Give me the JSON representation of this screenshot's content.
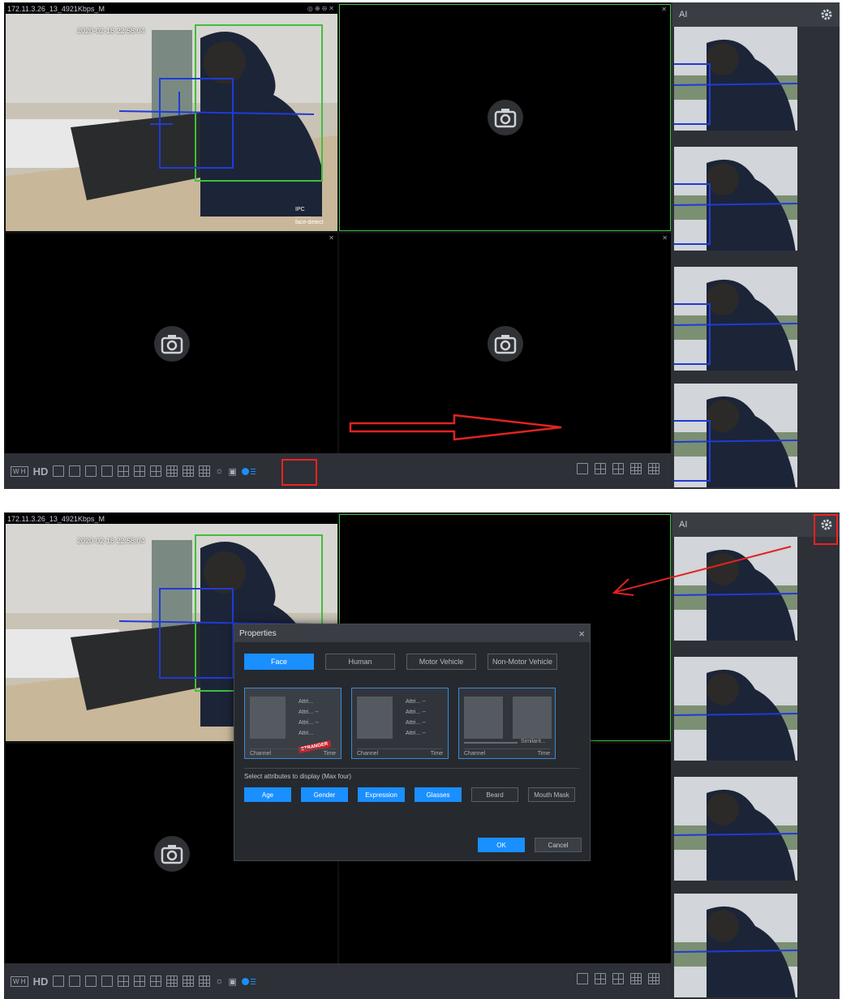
{
  "channel_title": "172.11.3.26_13_4921Kbps_M",
  "osd_timestamp": "2020-02-18 22:58:04",
  "osd_lines": [
    "IPC",
    "..........",
    "",
    "face-detect"
  ],
  "toolbar": {
    "wh_label": "W H",
    "hd_label": "HD"
  },
  "ai_panel": {
    "title": "AI"
  },
  "dialog": {
    "title": "Properties",
    "close": "×",
    "tabs": [
      "Face",
      "Human",
      "Motor Vehicle",
      "Non-Motor Vehicle"
    ],
    "previews": [
      {
        "attrs": [
          "Attri...",
          "Attri... --",
          "Attri... --",
          "Attri..."
        ],
        "channel": "Channel",
        "time": "Time",
        "stamp": "STRANGER"
      },
      {
        "attrs": [
          "Attri... --",
          "Attri... --",
          "Attri... --",
          "Attri... --"
        ],
        "channel": "Channel",
        "time": "Time"
      },
      {
        "similarity": "Similarit...",
        "channel": "Channel",
        "time": "Time"
      }
    ],
    "attr_label": "Select attributes to display (Max four)",
    "attributes": [
      {
        "label": "Age",
        "on": true
      },
      {
        "label": "Gender",
        "on": true
      },
      {
        "label": "Expression",
        "on": true
      },
      {
        "label": "Glasses",
        "on": true
      },
      {
        "label": "Beard",
        "on": false
      },
      {
        "label": "Mouth Mask",
        "on": false
      }
    ],
    "ok": "OK",
    "cancel": "Cancel"
  },
  "colors": {
    "accent": "#1a8fff",
    "annotation_red": "#e22222",
    "detect_green": "#3fbf3f",
    "detect_blue": "#1f3bd8"
  }
}
